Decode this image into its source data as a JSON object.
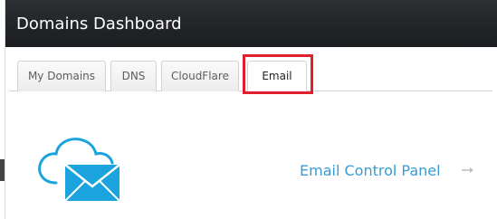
{
  "header": {
    "title": "Domains Dashboard"
  },
  "tabs": [
    {
      "label": "My Domains",
      "active": false
    },
    {
      "label": "DNS",
      "active": false
    },
    {
      "label": "CloudFlare",
      "active": false
    },
    {
      "label": "Email",
      "active": true
    }
  ],
  "main": {
    "email_link_label": "Email Control Panel",
    "icons": {
      "cloud": "cloud-email-icon",
      "arrow": "arrow-right-icon"
    }
  },
  "colors": {
    "header_bg": "#23262a",
    "link": "#3a9bd5",
    "highlight": "#e0202c",
    "icon_blue": "#1aa3dd"
  }
}
